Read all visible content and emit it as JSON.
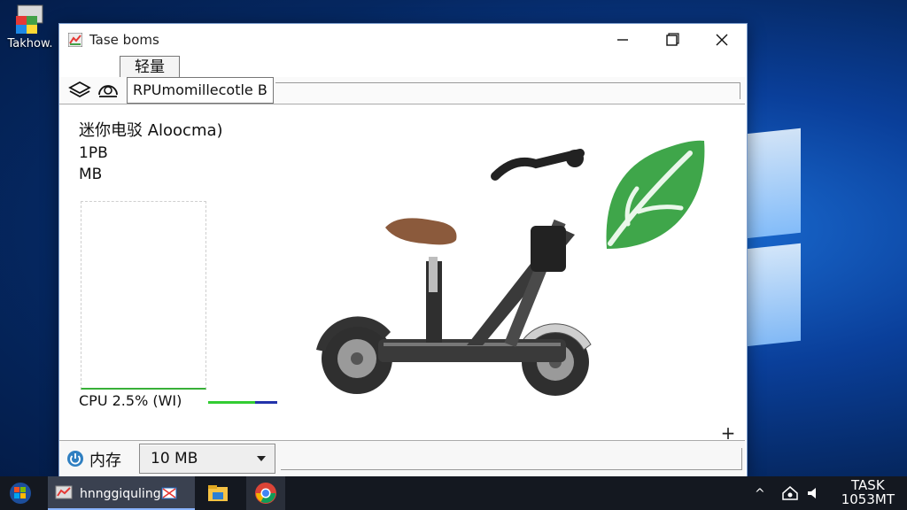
{
  "desktop": {
    "icon_label": "Takhow."
  },
  "window": {
    "title": "Tase boms",
    "float_tab": "轻量",
    "tab_label": "RPUmomillecotle B",
    "heading": "迷你电驳 Aloocma)",
    "stat_1": "1PB",
    "stat_2": "MB",
    "cpu_label": "CPU  2.5%  (WI)",
    "cpu_percent": 2.5,
    "plus_label": "+",
    "memory_label": "内存",
    "memory_value": "10 MB"
  },
  "taskbar": {
    "active_task_label": "hnnggiquling",
    "tray_arrow": "^",
    "clock_line1": "TASK",
    "clock_line2": "1053MT"
  },
  "colors": {
    "accent_green": "#33cc33",
    "accent_blue": "#2233aa",
    "desktop_blue": "#0a3f9a",
    "taskbar": "#141820"
  },
  "icons": {
    "app": "task-manager-icon",
    "tool_1": "stack-icon",
    "tool_2": "gauge-icon",
    "memory": "power-icon",
    "leaf": "leaf-icon"
  }
}
